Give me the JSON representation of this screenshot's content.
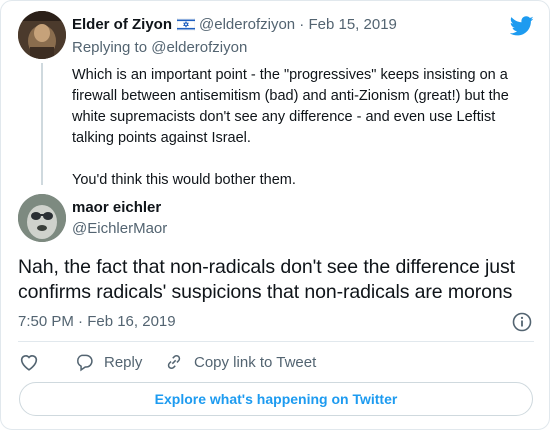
{
  "reply_tweet": {
    "display_name": "Elder of Ziyon",
    "handle": "@elderofziyon",
    "separator": "·",
    "date": "Feb 15, 2019",
    "replying_prefix": "Replying to",
    "replying_to": "@elderofziyon",
    "paragraphs": [
      "Which is an important point - the \"progressives\" keeps insisting on a firewall between antisemitism (bad) and anti-Zionism (great!) but the white supremacists don't see any difference - and even use Leftist talking points against Israel.",
      "You'd think this would bother them."
    ],
    "flag_icon": "israel-flag-icon"
  },
  "main_tweet": {
    "display_name": "maor eichler",
    "handle": "@EichlerMaor",
    "text": "Nah, the fact that non-radicals don't see the difference just confirms radicals' suspicions that non-radicals are morons",
    "timestamp": "7:50 PM · Feb 16, 2019"
  },
  "actions": {
    "reply_label": "Reply",
    "copy_label": "Copy link to Tweet"
  },
  "explore_label": "Explore what's happening on Twitter",
  "colors": {
    "accent": "#1d9bf0",
    "text": "#0f1419",
    "secondary_text": "#536471",
    "border": "#e1e8ed"
  },
  "icons": {
    "brand": "twitter-bird-icon",
    "info": "info-icon",
    "like": "heart-icon",
    "reply": "reply-bubble-icon",
    "copy": "link-icon"
  }
}
